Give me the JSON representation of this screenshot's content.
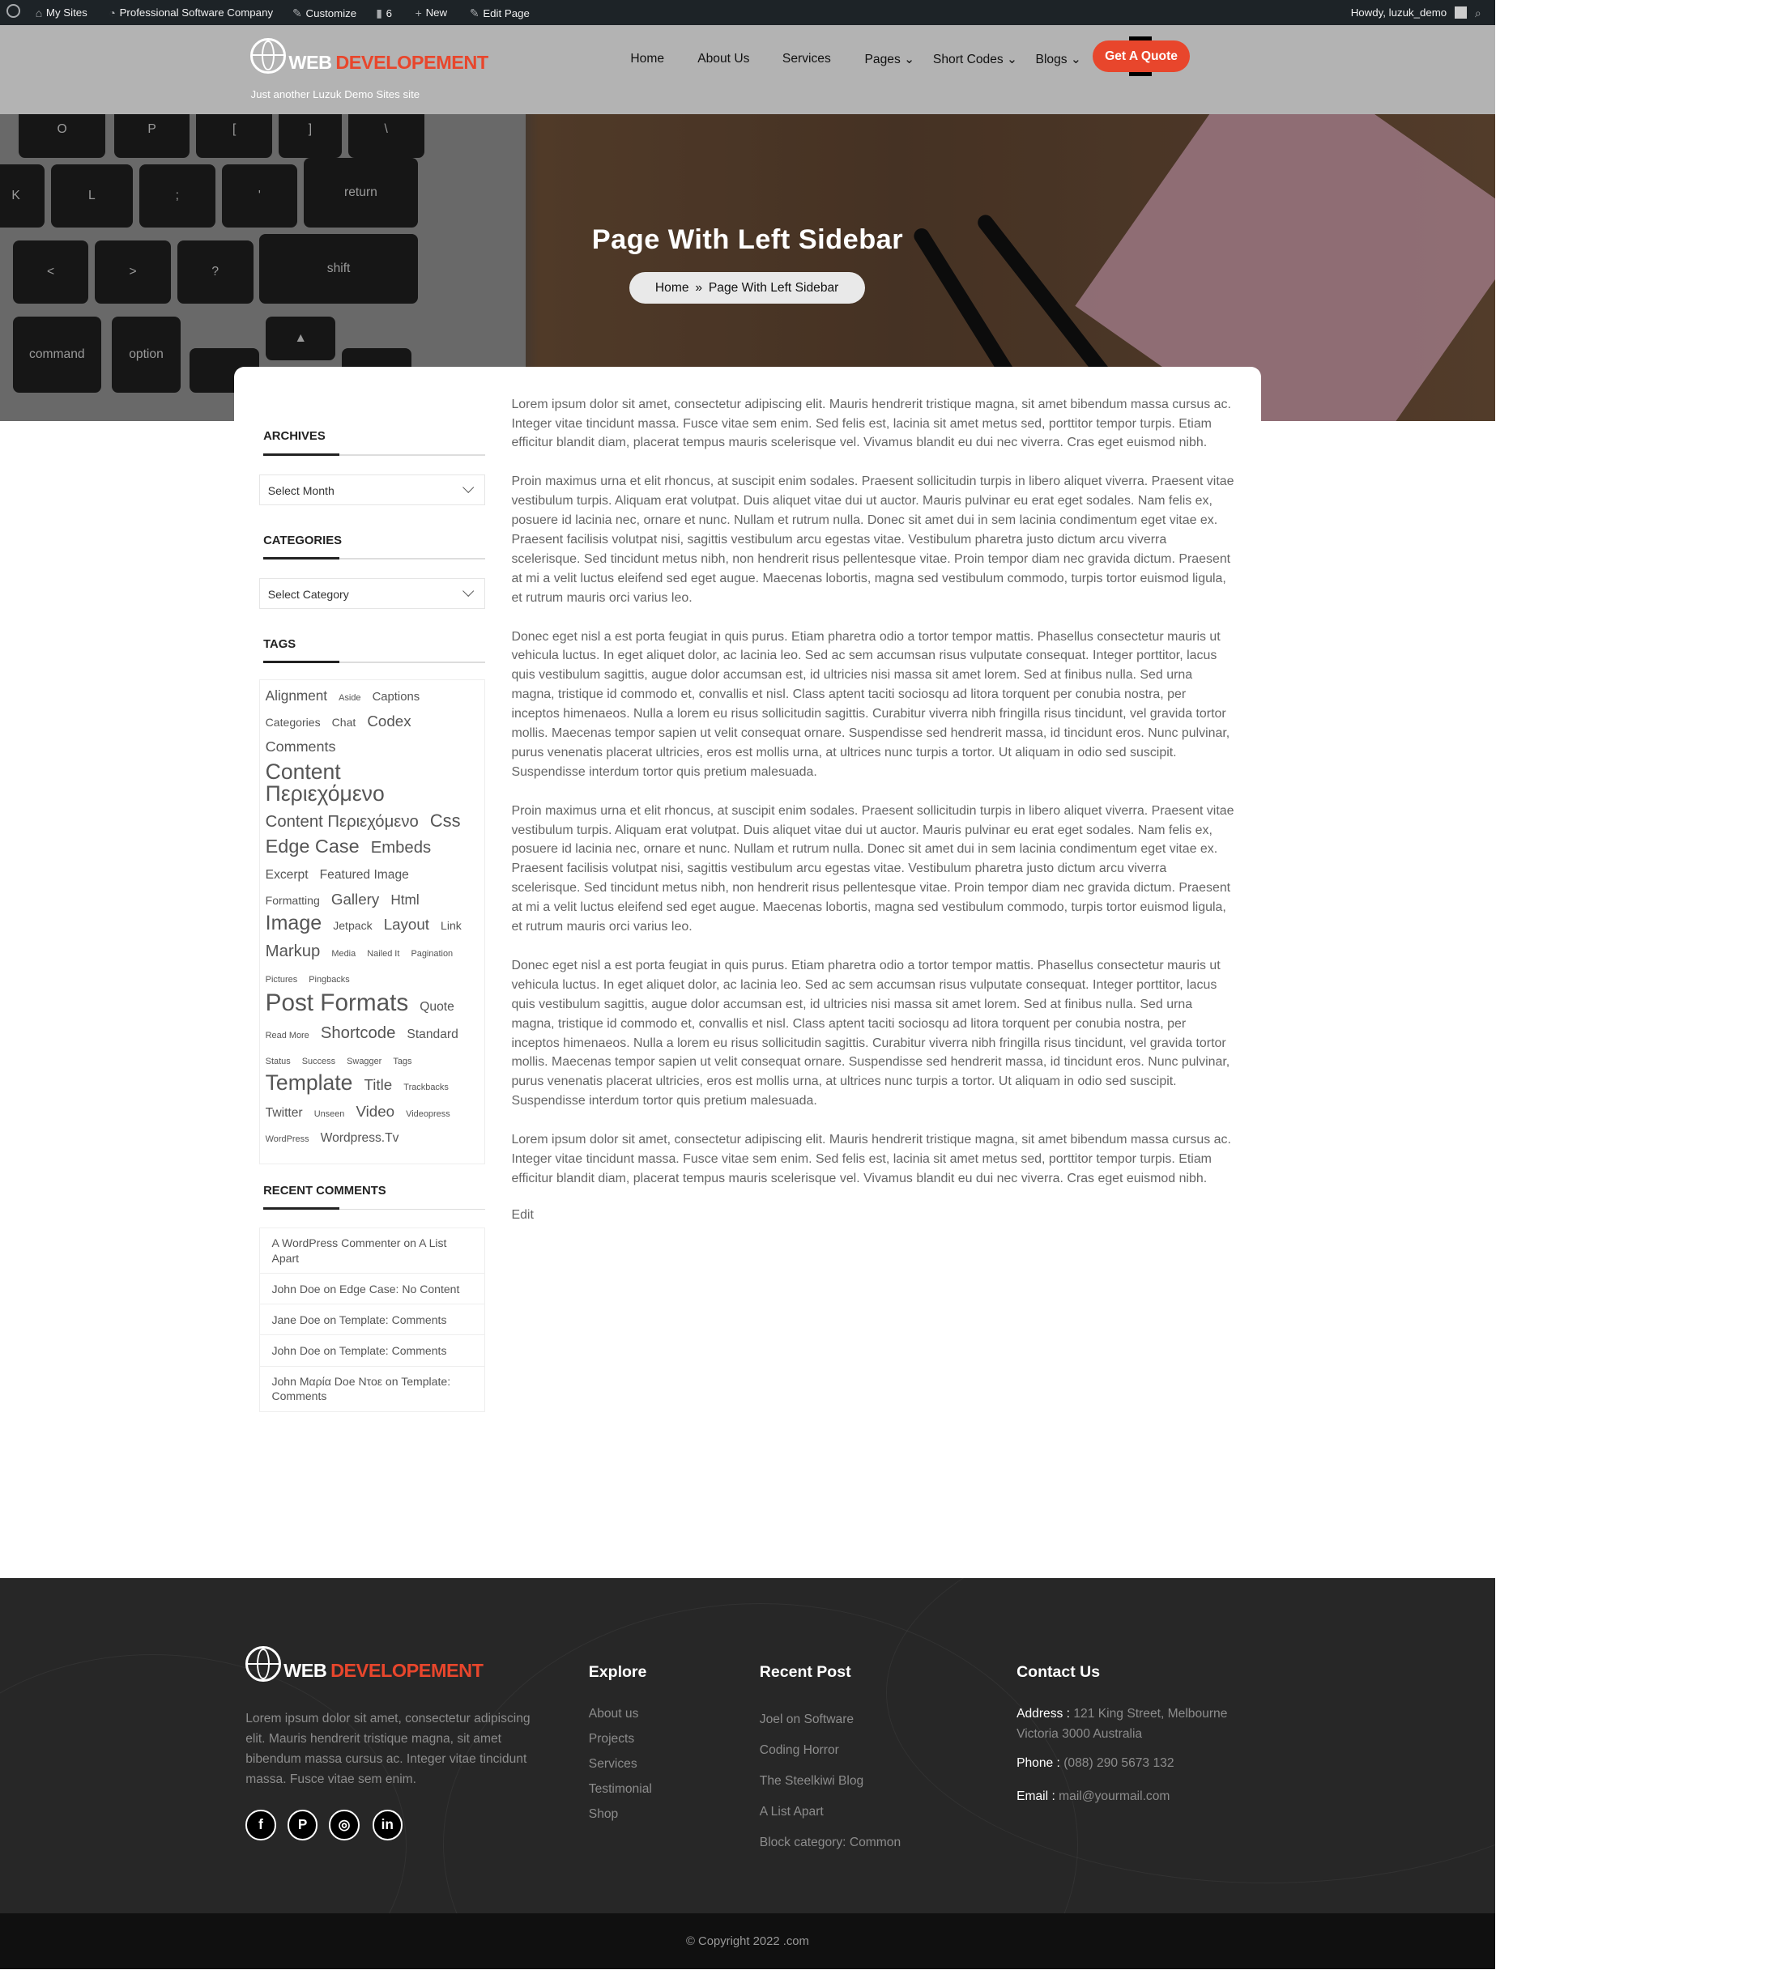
{
  "colors": {
    "accent": "#e8462c",
    "admin_bar": "#1d2327",
    "header_bg": "#b3b3b3",
    "footer_bg": "#272727"
  },
  "admin_bar": {
    "items": [
      {
        "icon": "wordpress-icon",
        "label": ""
      },
      {
        "icon": "my-sites-icon",
        "label": "My Sites"
      },
      {
        "icon": "dashboard-icon",
        "label": "Professional Software Company"
      },
      {
        "icon": "brush-icon",
        "label": "Customize"
      },
      {
        "icon": "comment-icon",
        "label": "6"
      },
      {
        "icon": "plus-icon",
        "label": "New"
      },
      {
        "icon": "pencil-icon",
        "label": "Edit Page"
      }
    ],
    "howdy": "Howdy, luzuk_demo"
  },
  "header": {
    "logo_web": "WEB",
    "logo_dev": "DEVELOPEMENT",
    "tagline": "Just another Luzuk Demo Sites site",
    "nav": [
      {
        "label": "Home"
      },
      {
        "label": "About Us"
      },
      {
        "label": "Services"
      },
      {
        "label": "Pages",
        "dropdown": true
      },
      {
        "label": "Short Codes",
        "dropdown": true
      },
      {
        "label": "Blogs",
        "dropdown": true
      }
    ],
    "cta": "Get A Quote"
  },
  "hero": {
    "title": "Page With Left Sidebar",
    "breadcrumb": {
      "home": "Home",
      "current": "Page With Left Sidebar"
    }
  },
  "sidebar": {
    "archives": {
      "title": "ARCHIVES",
      "select": "Select Month"
    },
    "categories": {
      "title": "CATEGORIES",
      "select": "Select Category"
    },
    "tags": {
      "title": "TAGS",
      "items": [
        "Alignment",
        "Aside",
        "Captions",
        "Categories",
        "Chat",
        "Codex",
        "Comments",
        "Content Περιεχόμενο",
        "Content Περιεχόμενο",
        "Css",
        "Edge Case",
        "Embeds",
        "Excerpt",
        "Featured Image",
        "Formatting",
        "Gallery",
        "Html",
        "Image",
        "Jetpack",
        "Layout",
        "Link",
        "Markup",
        "Media",
        "Nailed It",
        "Pagination",
        "Pictures",
        "Pingbacks",
        "Post Formats",
        "Quote",
        "Read More",
        "Shortcode",
        "Standard",
        "Status",
        "Success",
        "Swagger",
        "Tags",
        "Template",
        "Title",
        "Trackbacks",
        "Twitter",
        "Unseen",
        "Video",
        "Videopress",
        "WordPress",
        "Wordpress.Tv"
      ]
    },
    "recent_comments": {
      "title": "RECENT COMMENTS",
      "items": [
        "A WordPress Commenter on A List Apart",
        "John Doe on Edge Case: No Content",
        "Jane Doe on Template: Comments",
        "John Doe on Template: Comments",
        "John Μαρία Doe Ντοε on Template: Comments"
      ]
    }
  },
  "main": {
    "paragraphs": [
      "Lorem ipsum dolor sit amet, consectetur adipiscing elit. Mauris hendrerit tristique magna, sit amet bibendum massa cursus ac. Integer vitae tincidunt massa. Fusce vitae sem enim. Sed felis est, lacinia sit amet metus sed, porttitor tempor turpis. Etiam efficitur blandit diam, placerat tempus mauris scelerisque vel. Vivamus blandit eu dui nec viverra. Cras eget euismod nibh.",
      "Proin maximus urna et elit rhoncus, at suscipit enim sodales. Praesent sollicitudin turpis in libero aliquet viverra. Praesent vitae vestibulum turpis. Aliquam erat volutpat. Duis aliquet vitae dui ut auctor. Mauris pulvinar eu erat eget sodales. Nam felis ex, posuere id lacinia nec, ornare et nunc. Nullam et rutrum nulla. Donec sit amet dui in sem lacinia condimentum eget vitae ex. Praesent facilisis volutpat nisi, sagittis vestibulum arcu egestas vitae. Vestibulum pharetra justo dictum arcu viverra scelerisque. Sed tincidunt metus nibh, non hendrerit risus pellentesque vitae. Proin tempor diam nec gravida dictum. Praesent at mi a velit luctus eleifend sed eget augue. Maecenas lobortis, magna sed vestibulum commodo, turpis tortor euismod ligula, et rutrum mauris orci varius leo.",
      "Donec eget nisl a est porta feugiat in quis purus. Etiam pharetra odio a tortor tempor mattis. Phasellus consectetur mauris ut vehicula luctus. In eget aliquet dolor, ac lacinia leo. Sed ac sem accumsan risus vulputate consequat. Integer porttitor, lacus quis vestibulum sagittis, augue dolor accumsan est, id ultricies nisi massa sit amet lorem. Sed at finibus nulla. Sed urna magna, tristique id commodo et, convallis et nisl. Class aptent taciti sociosqu ad litora torquent per conubia nostra, per inceptos himenaeos. Nulla a lorem eu risus sollicitudin sagittis. Curabitur viverra nibh fringilla risus tincidunt, vel gravida tortor mollis. Maecenas tempor sapien ut velit consequat ornare. Suspendisse sed hendrerit massa, id tincidunt eros. Nunc pulvinar, purus venenatis placerat ultricies, eros est mollis urna, at ultrices nunc turpis a tortor. Ut aliquam in odio sed suscipit. Suspendisse interdum tortor quis pretium malesuada.",
      "Proin maximus urna et elit rhoncus, at suscipit enim sodales. Praesent sollicitudin turpis in libero aliquet viverra. Praesent vitae vestibulum turpis. Aliquam erat volutpat. Duis aliquet vitae dui ut auctor. Mauris pulvinar eu erat eget sodales. Nam felis ex, posuere id lacinia nec, ornare et nunc. Nullam et rutrum nulla. Donec sit amet dui in sem lacinia condimentum eget vitae ex. Praesent facilisis volutpat nisi, sagittis vestibulum arcu egestas vitae. Vestibulum pharetra justo dictum arcu viverra scelerisque. Sed tincidunt metus nibh, non hendrerit risus pellentesque vitae. Proin tempor diam nec gravida dictum. Praesent at mi a velit luctus eleifend sed eget augue. Maecenas lobortis, magna sed vestibulum commodo, turpis tortor euismod ligula, et rutrum mauris orci varius leo.",
      "Donec eget nisl a est porta feugiat in quis purus. Etiam pharetra odio a tortor tempor mattis. Phasellus consectetur mauris ut vehicula luctus. In eget aliquet dolor, ac lacinia leo. Sed ac sem accumsan risus vulputate consequat. Integer porttitor, lacus quis vestibulum sagittis, augue dolor accumsan est, id ultricies nisi massa sit amet lorem. Sed at finibus nulla. Sed urna magna, tristique id commodo et, convallis et nisl. Class aptent taciti sociosqu ad litora torquent per conubia nostra, per inceptos himenaeos. Nulla a lorem eu risus sollicitudin sagittis. Curabitur viverra nibh fringilla risus tincidunt, vel gravida tortor mollis. Maecenas tempor sapien ut velit consequat ornare. Suspendisse sed hendrerit massa, id tincidunt eros. Nunc pulvinar, purus venenatis placerat ultricies, eros est mollis urna, at ultrices nunc turpis a tortor. Ut aliquam in odio sed suscipit. Suspendisse interdum tortor quis pretium malesuada.",
      "Lorem ipsum dolor sit amet, consectetur adipiscing elit. Mauris hendrerit tristique magna, sit amet bibendum massa cursus ac. Integer vitae tincidunt massa. Fusce vitae sem enim. Sed felis est, lacinia sit amet metus sed, porttitor tempor turpis. Etiam efficitur blandit diam, placerat tempus mauris scelerisque vel. Vivamus blandit eu dui nec viverra. Cras eget euismod nibh."
    ],
    "edit": "Edit"
  },
  "footer": {
    "about": "Lorem ipsum dolor sit amet, consectetur adipiscing elit. Mauris hendrerit tristique magna, sit amet bibendum massa cursus ac. Integer vitae tincidunt massa. Fusce vitae sem enim.",
    "social": [
      "facebook",
      "pinterest",
      "instagram",
      "linkedin"
    ],
    "explore": {
      "title": "Explore",
      "links": [
        "About us",
        "Projects",
        "Services",
        "Testimonial",
        "Shop"
      ]
    },
    "recent": {
      "title": "Recent Post",
      "links": [
        "Joel on Software",
        "Coding Horror",
        "The Steelkiwi Blog",
        "A List Apart",
        "Block category: Common"
      ]
    },
    "contact": {
      "title": "Contact Us",
      "address_label": "Address :",
      "address": "121 King Street, Melbourne Victoria 3000 Australia",
      "phone_label": "Phone :",
      "phone": "(088) 290 5673 132",
      "email_label": "Email :",
      "email": "mail@yourmail.com"
    },
    "copyright": "© Copyright 2022 .com"
  }
}
